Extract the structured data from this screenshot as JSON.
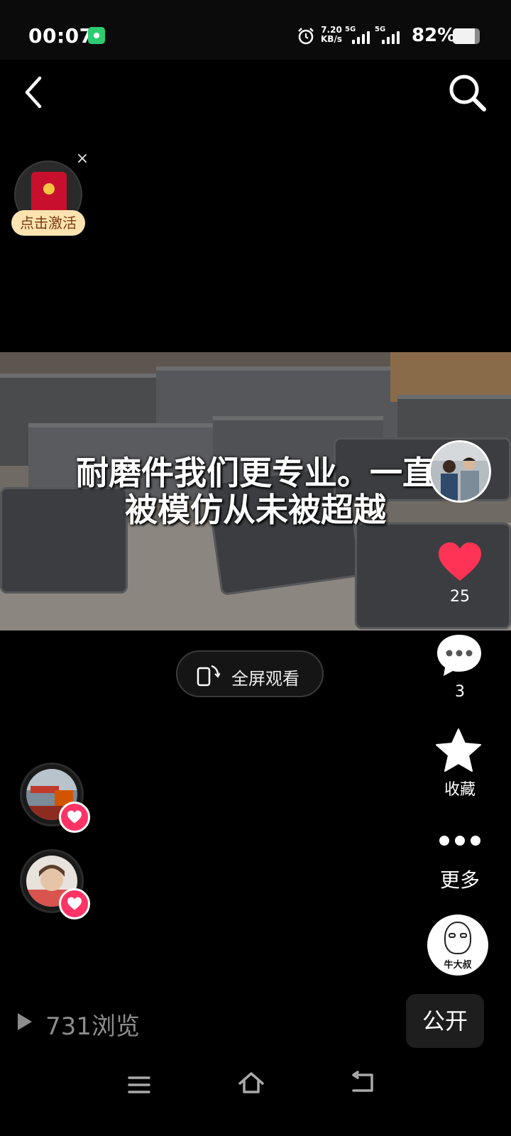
{
  "status_bar": {
    "time": "00:07",
    "net_speed_value": "7.20",
    "net_speed_unit": "KB/s",
    "sim1_label": "5G",
    "sim2_label": "5G",
    "battery_text": "82%",
    "battery_level": 0.82
  },
  "nav": {
    "back_icon": "chevron-left-icon",
    "search_icon": "search-icon"
  },
  "red_packet": {
    "label": "点击激活",
    "close": "×"
  },
  "video": {
    "caption_line1": "耐磨件我们更专业。一直",
    "caption_line2": "被模仿从未被超越"
  },
  "actions": {
    "like_count": "25",
    "comment_count": "3",
    "favorite_label": "收藏",
    "more_label": "更多"
  },
  "creator": {
    "avatar_mark": "牛大叔"
  },
  "fullscreen": {
    "label": "全屏观看"
  },
  "footer": {
    "views": "731浏览",
    "public_label": "公开"
  },
  "colors": {
    "like": "#ff3355",
    "badge": "#ff3366",
    "redpack_label_bg": "#fde3b0"
  }
}
